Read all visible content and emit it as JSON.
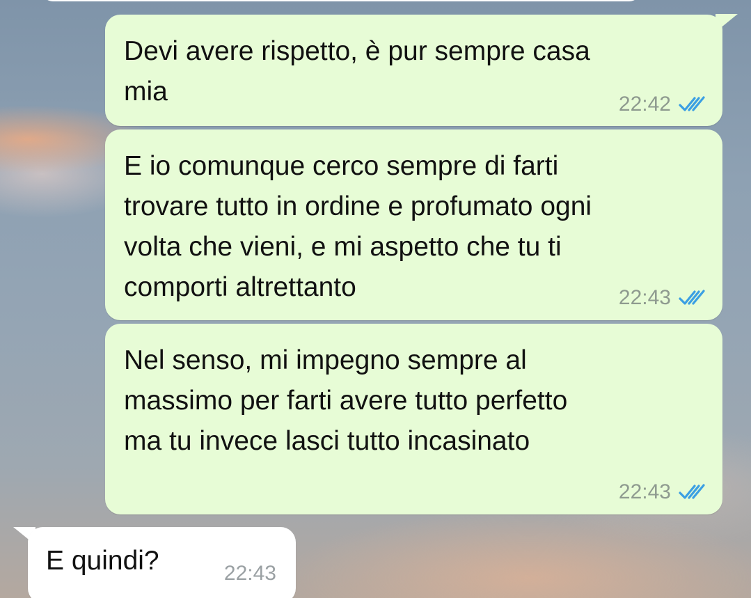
{
  "chat": {
    "messages": [
      {
        "direction": "outgoing",
        "text": "Devi avere rispetto, è pur sempre casa\nmia",
        "time": "22:42",
        "status": "read"
      },
      {
        "direction": "outgoing",
        "text": "E io comunque cerco sempre di farti\ntrovare tutto in ordine e profumato ogni\nvolta che vieni, e mi aspetto che tu ti\ncomporti altrettanto",
        "time": "22:43",
        "status": "read"
      },
      {
        "direction": "outgoing",
        "text": "Nel senso, mi impegno sempre al\nmassimo per farti avere tutto perfetto\nma tu invece lasci tutto incasinato",
        "time": "22:43",
        "status": "read"
      },
      {
        "direction": "incoming",
        "text": "E quindi?",
        "time": "22:43"
      }
    ]
  },
  "colors": {
    "outgoing_bubble": "#e7fcd6",
    "incoming_bubble": "#ffffff",
    "read_ticks": "#3b9fe3",
    "timestamp": "#8e9a8f"
  },
  "icons": {
    "read_receipt": "double-check-icon"
  }
}
